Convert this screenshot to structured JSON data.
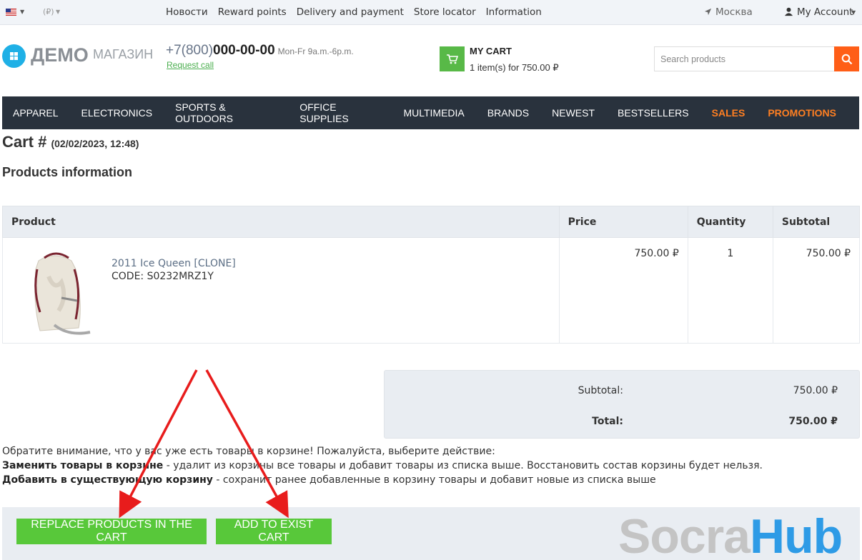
{
  "topbar": {
    "currency": "(₽)",
    "links": [
      "Новости",
      "Reward points",
      "Delivery and payment",
      "Store locator",
      "Information"
    ],
    "city": "Москва",
    "account": "My Account"
  },
  "header": {
    "logo_main": "ДЕМО",
    "logo_sub": "МАГАЗИН",
    "phone_prefix": "+7(800)",
    "phone_number": "000-00-00",
    "hours": "Mon-Fr 9a.m.-6p.m.",
    "request_call": "Request call",
    "cart_title": "MY CART",
    "cart_summary": "1 item(s) for 750.00 ₽",
    "search_placeholder": "Search products"
  },
  "nav": {
    "items": [
      "APPAREL",
      "ELECTRONICS",
      "SPORTS & OUTDOORS",
      "OFFICE SUPPLIES",
      "MULTIMEDIA",
      "BRANDS",
      "NEWEST",
      "BESTSELLERS",
      "SALES",
      "PROMOTIONS"
    ],
    "highlight_color": "#ff7f22"
  },
  "cart": {
    "title": "Cart #",
    "date": "(02/02/2023, 12:48)",
    "section": "Products information",
    "columns": [
      "Product",
      "Price",
      "Quantity",
      "Subtotal"
    ],
    "rows": [
      {
        "name": "2011 Ice Queen [CLONE]",
        "code": "CODE: S0232MRZ1Y",
        "price": "750.00 ₽",
        "qty": "1",
        "subtotal": "750.00 ₽"
      }
    ]
  },
  "totals": {
    "subtotal_label": "Subtotal:",
    "subtotal_value": "750.00 ₽",
    "total_label": "Total:",
    "total_value": "750.00 ₽"
  },
  "notice": {
    "line1": "Обратите внимание, что у вас уже есть товары в корзине! Пожалуйста, выберите действие:",
    "replace_bold": "Заменить товары в корзине",
    "replace_text": " - удалит из корзины все товары и добавит товары из списка выше. Восстановить состав корзины будет нельзя.",
    "add_bold": "Добавить в существующую корзину",
    "add_text": " - сохранит ранее добавленные в корзину товары и добавит новые из списка выше"
  },
  "actions": {
    "replace": "REPLACE PRODUCTS IN THE CART",
    "add": "ADD TO EXIST CART"
  },
  "watermark": {
    "part1": "Socra",
    "part2": "Hub"
  },
  "colors": {
    "accent_green": "#58c83a",
    "search_orange": "#ff5e17",
    "nav_bg": "#29323d",
    "arrow_red": "#e81c1c"
  }
}
